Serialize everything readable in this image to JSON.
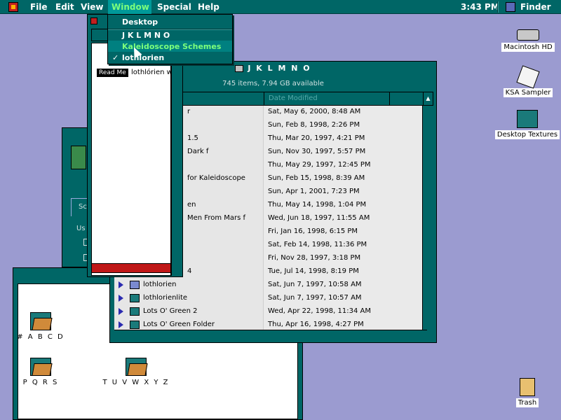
{
  "menubar": {
    "items": [
      "File",
      "Edit",
      "View",
      "Window",
      "Special",
      "Help"
    ],
    "clock": "3:43 PM",
    "app_name": "Finder"
  },
  "window_menu": {
    "items": [
      {
        "label": "Desktop",
        "checked": false,
        "highlighted": false
      },
      {
        "label": "J K L M N O",
        "checked": false,
        "highlighted": false
      },
      {
        "label": "Kaleidoscope Schemes",
        "checked": false,
        "highlighted": true
      },
      {
        "label": "lothlorien",
        "checked": true,
        "highlighted": false
      }
    ],
    "check_glyph": "✓"
  },
  "narrow_window": {
    "badge": "Read Me",
    "item_label": "lothlórien wi"
  },
  "main_window": {
    "title": "J K L M N O",
    "info": "745 items, 7.94 GB available",
    "column_header_date": "Date Modified",
    "sort_glyph": "▲",
    "rows": [
      {
        "name": "r",
        "date": "Sat, May 6, 2000, 8:48 AM",
        "show_icon": false
      },
      {
        "name": "",
        "date": "Sun, Feb 8, 1998, 2:26 PM",
        "show_icon": false
      },
      {
        "name": "1.5",
        "date": "Thu, Mar 20, 1997, 4:21 PM",
        "show_icon": false
      },
      {
        "name": "Dark f",
        "date": "Sun, Nov 30, 1997, 5:57 PM",
        "show_icon": false
      },
      {
        "name": "",
        "date": "Thu, May 29, 1997, 12:45 PM",
        "show_icon": false
      },
      {
        "name": "for Kaleidoscope",
        "date": "Sun, Feb 15, 1998, 8:39 AM",
        "show_icon": false
      },
      {
        "name": "",
        "date": "Sun, Apr 1, 2001, 7:23 PM",
        "show_icon": false
      },
      {
        "name": "en",
        "date": "Thu, May 14, 1998, 1:04 PM",
        "show_icon": false
      },
      {
        "name": "Men From Mars f",
        "date": "Wed, Jun 18, 1997, 11:55 AM",
        "show_icon": false
      },
      {
        "name": "",
        "date": "Fri, Jan 16, 1998, 6:15 PM",
        "show_icon": false
      },
      {
        "name": "",
        "date": "Sat, Feb 14, 1998, 11:36 PM",
        "show_icon": false
      },
      {
        "name": "",
        "date": "Fri, Nov 28, 1997, 3:18 PM",
        "show_icon": false
      },
      {
        "name": "4",
        "date": "Tue, Jul 14, 1998, 8:19 PM",
        "show_icon": false
      },
      {
        "name": "lothlorien",
        "date": "Sat, Jun 7, 1997, 10:58 AM",
        "show_icon": true,
        "icon_color": "#7a8ad0"
      },
      {
        "name": "lothlorienlite",
        "date": "Sat, Jun 7, 1997, 10:57 AM",
        "show_icon": true,
        "icon_color": "#1a7a7a"
      },
      {
        "name": "Lots O' Green 2",
        "date": "Wed, Apr 22, 1998, 11:34 AM",
        "show_icon": true,
        "icon_color": "#1a7a7a"
      },
      {
        "name": "Lots O' Green Folder",
        "date": "Thu, Apr 16, 1998, 4:27 PM",
        "show_icon": true,
        "icon_color": "#1a7a7a"
      }
    ]
  },
  "mid_window": {
    "tab_label": "Sc",
    "text": "Us"
  },
  "bottom_window": {
    "folders": [
      "# A B C D",
      "P Q R S",
      "T U V W X Y Z"
    ]
  },
  "desktop_icons": [
    {
      "label": "Macintosh HD",
      "icon": "hard-drive-icon"
    },
    {
      "label": "KSA Sampler",
      "icon": "document-icon"
    },
    {
      "label": "Desktop Textures",
      "icon": "folder-icon"
    },
    {
      "label": "Trash",
      "icon": "trash-icon"
    }
  ],
  "colors": {
    "desktop": "#9b9bd0",
    "chrome": "#006666",
    "highlight_text": "#7cff7c"
  }
}
